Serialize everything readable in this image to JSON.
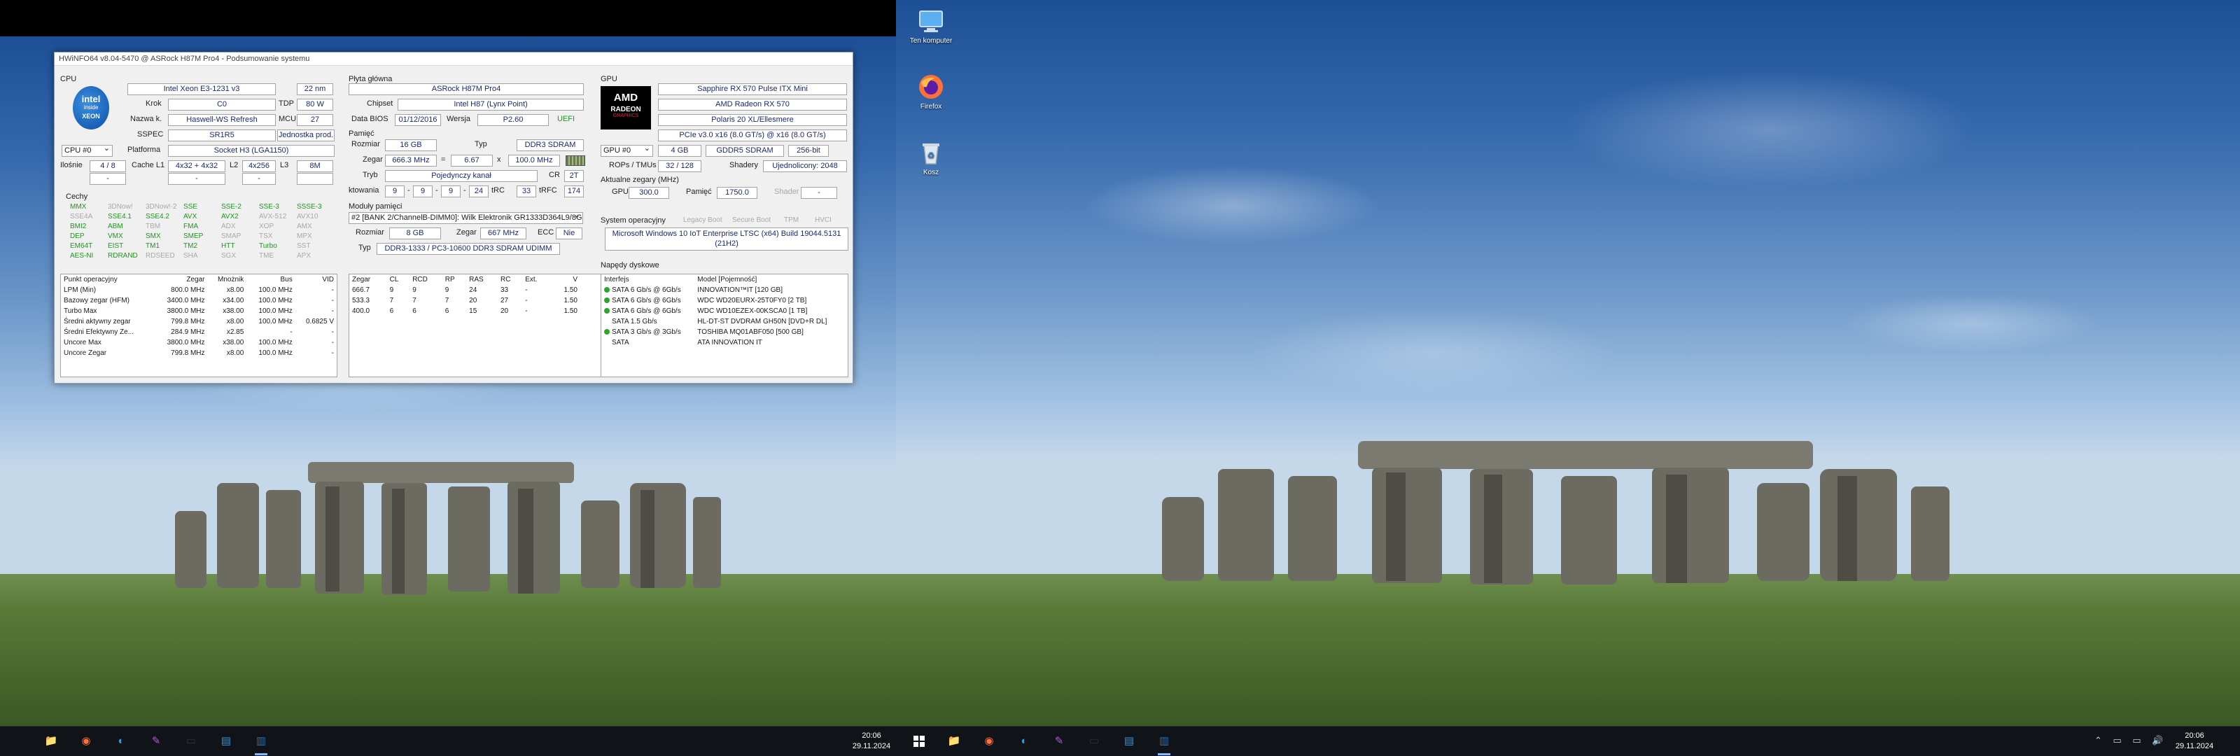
{
  "window": {
    "title": "HWiNFO64 v8.04-5470 @ ASRock H87M Pro4 - Podsumowanie systemu"
  },
  "cpu": {
    "section": "CPU",
    "logo": {
      "brand": "intel",
      "inside": "inside",
      "name": "XEON"
    },
    "model": "Intel Xeon E3-1231 v3",
    "process": "22 nm",
    "stepping_label": "Krok",
    "stepping": "C0",
    "tdp_label": "TDP",
    "tdp": "80 W",
    "codename_label": "Nazwa k.",
    "codename": "Haswell-WS Refresh",
    "mcu_label": "MCU",
    "mcu": "27",
    "sspec_label": "SSPEC",
    "sspec": "SR1R5",
    "prod_unit": "Jednostka prod.",
    "selector": "CPU #0",
    "platform_label": "Platforma",
    "platform": "Socket H3 (LGA1150)",
    "cores_label": "Ilośnie",
    "cores": "4 / 8",
    "cache_l1_label": "Cache L1",
    "cache_l1": "4x32 + 4x32",
    "l2_label": "L2",
    "l2": "4x256",
    "l3_label": "L3",
    "l3": "8M",
    "features_label": "Cechy",
    "features": [
      [
        "MMX",
        "on"
      ],
      [
        "3DNow!",
        "off"
      ],
      [
        "3DNow!-2",
        "off"
      ],
      [
        "SSE",
        "on"
      ],
      [
        "SSE-2",
        "on"
      ],
      [
        "SSE-3",
        "on"
      ],
      [
        "SSSE-3",
        "on"
      ],
      [
        "SSE4A",
        "off"
      ],
      [
        "SSE4.1",
        "on"
      ],
      [
        "SSE4.2",
        "on"
      ],
      [
        "AVX",
        "on"
      ],
      [
        "AVX2",
        "on"
      ],
      [
        "AVX-512",
        "off"
      ],
      [
        "AVX10",
        "off"
      ],
      [
        "BMI2",
        "on"
      ],
      [
        "ABM",
        "on"
      ],
      [
        "TBM",
        "off"
      ],
      [
        "FMA",
        "on"
      ],
      [
        "ADX",
        "off"
      ],
      [
        "XOP",
        "off"
      ],
      [
        "AMX",
        "off"
      ],
      [
        "DEP",
        "on"
      ],
      [
        "VMX",
        "on"
      ],
      [
        "SMX",
        "on"
      ],
      [
        "SMEP",
        "on"
      ],
      [
        "SMAP",
        "off"
      ],
      [
        "TSX",
        "off"
      ],
      [
        "MPX",
        "off"
      ],
      [
        "EM64T",
        "on"
      ],
      [
        "EIST",
        "on"
      ],
      [
        "TM1",
        "on"
      ],
      [
        "TM2",
        "on"
      ],
      [
        "HTT",
        "on"
      ],
      [
        "Turbo",
        "on"
      ],
      [
        "SST",
        "off"
      ],
      [
        "AES-NI",
        "on"
      ],
      [
        "RDRAND",
        "on"
      ],
      [
        "RDSEED",
        "off"
      ],
      [
        "SHA",
        "off"
      ],
      [
        "SGX",
        "off"
      ],
      [
        "TME",
        "off"
      ],
      [
        "APX",
        "off"
      ]
    ],
    "op_table": {
      "headers": [
        "Punkt operacyjny",
        "Zegar",
        "Mnożnik",
        "Bus",
        "VID"
      ],
      "rows": [
        [
          "LPM (Min)",
          "800.0 MHz",
          "x8.00",
          "100.0 MHz",
          "-"
        ],
        [
          "Bazowy zegar (HFM)",
          "3400.0 MHz",
          "x34.00",
          "100.0 MHz",
          "-"
        ],
        [
          "Turbo Max",
          "3800.0 MHz",
          "x38.00",
          "100.0 MHz",
          "-"
        ],
        [
          "Średni aktywny zegar",
          "799.8 MHz",
          "x8.00",
          "100.0 MHz",
          "0.6825 V"
        ],
        [
          "Średni Efektywny Ze...",
          "284.9 MHz",
          "x2.85",
          "-",
          "-"
        ],
        [
          "Uncore Max",
          "3800.0 MHz",
          "x38.00",
          "100.0 MHz",
          "-"
        ],
        [
          "Uncore Zegar",
          "799.8 MHz",
          "x8.00",
          "100.0 MHz",
          "-"
        ]
      ]
    }
  },
  "mobo": {
    "section": "Płyta główna",
    "model": "ASRock H87M Pro4",
    "chipset_label": "Chipset",
    "chipset": "Intel H87 (Lynx Point)",
    "bios_label": "Data BIOS",
    "bios_date": "01/12/2016",
    "version_label": "Wersja",
    "version": "P2.60",
    "uefi": "UEFI"
  },
  "memory": {
    "section": "Pamięć",
    "size_label": "Rozmiar",
    "size": "16 GB",
    "type_label": "Typ",
    "type": "DDR3 SDRAM",
    "clock_label": "Zegar",
    "clock": "666.3 MHz",
    "eq": "=",
    "mult": "6.67",
    "x": "x",
    "bus": "100.0 MHz",
    "mode_label": "Tryb",
    "mode": "Pojedynczy kanał",
    "cr_label": "CR",
    "cr": "2T",
    "timing_label": "ktowania",
    "t1": "9",
    "t2": "9",
    "t3": "9",
    "t4": "24",
    "trc_label": "tRC",
    "trc": "33",
    "trfc_label": "tRFC",
    "trfc": "174",
    "modules_label": "Moduły pamięci",
    "module": "#2 [BANK 2/ChannelB-DIMM0]: Wilk Elektronik GR1333D364L9/8G",
    "m_size_label": "Rozmiar",
    "m_size": "8 GB",
    "m_clock_label": "Zegar",
    "m_clock": "667 MHz",
    "ecc_label": "ECC",
    "ecc": "Nie",
    "m_type_label": "Typ",
    "m_type": "DDR3-1333 / PC3-10600 DDR3 SDRAM UDIMM",
    "timing_table": {
      "headers": [
        "Zegar",
        "CL",
        "RCD",
        "RP",
        "RAS",
        "RC",
        "Ext.",
        "V"
      ],
      "rows": [
        [
          "666.7",
          "9",
          "9",
          "9",
          "24",
          "33",
          "-",
          "1.50"
        ],
        [
          "533.3",
          "7",
          "7",
          "7",
          "20",
          "27",
          "-",
          "1.50"
        ],
        [
          "400.0",
          "6",
          "6",
          "6",
          "15",
          "20",
          "-",
          "1.50"
        ]
      ]
    }
  },
  "gpu": {
    "section": "GPU",
    "logo": {
      "brand": "AMD",
      "line1": "RADEON",
      "line2": "GRAPHICS"
    },
    "card": "Sapphire RX 570 Pulse ITX Mini",
    "chip": "AMD Radeon RX 570",
    "core": "Polaris 20 XL/Ellesmere",
    "pcie": "PCIe v3.0 x16 (8.0 GT/s) @ x16 (8.0 GT/s)",
    "selector": "GPU #0",
    "vram": "4 GB",
    "vram_type": "GDDR5 SDRAM",
    "bus_width": "256-bit",
    "rops_label": "ROPs / TMUs",
    "rops": "32 / 128",
    "shaders_label": "Shadery",
    "shaders": "Ujednolicony: 2048",
    "clocks_label": "Aktualne zegary (MHz)",
    "gpu_clk_label": "GPU",
    "gpu_clk": "300.0",
    "mem_clk_label": "Pamięć",
    "mem_clk": "1750.0",
    "shader_label": "Shader",
    "shader": "-"
  },
  "os": {
    "section": "System operacyjny",
    "flags": [
      "Legacy Boot",
      "Secure Boot",
      "TPM",
      "HVCI"
    ],
    "line1": "Microsoft Windows 10 IoT Enterprise LTSC (x64) Build 19044.5131",
    "line2": "(21H2)"
  },
  "drives": {
    "section": "Napędy dyskowe",
    "headers": [
      "Interfejs",
      "Model [Pojemność]"
    ],
    "rows": [
      [
        "SATA 6 Gb/s @ 6Gb/s",
        "INNOVATION™IT [120 GB]",
        true
      ],
      [
        "SATA 6 Gb/s @ 6Gb/s",
        "WDC WD20EURX-25T0FY0 [2 TB]",
        true
      ],
      [
        "SATA 6 Gb/s @ 6Gb/s",
        "WDC WD10EZEX-00KSCA0 [1 TB]",
        true
      ],
      [
        "SATA 1.5 Gb/s",
        "HL-DT-ST DVDRAM GH50N [DVD+R DL]",
        false
      ],
      [
        "SATA 3 Gb/s @ 3Gb/s",
        "TOSHIBA MQ01ABF050 [500 GB]",
        true
      ],
      [
        "SATA",
        "ATA INNOVATION  IT",
        false
      ]
    ]
  },
  "desktop": {
    "icons": [
      {
        "label": "Ten komputer",
        "icon": "computer-icon"
      },
      {
        "label": "Firefox",
        "icon": "firefox-icon"
      },
      {
        "label": "Kosz",
        "icon": "recycle-bin-icon"
      }
    ]
  },
  "taskbar": {
    "left_clock": {
      "time": "20:06",
      "date": "29.11.2024"
    },
    "right_clock": {
      "time": "20:06",
      "date": "29.11.2024"
    },
    "apps": [
      "file-explorer-icon",
      "firefox-icon",
      "edge-icon",
      "notepad-icon",
      "terminal-icon",
      "hwinfo-icon",
      "hwinfo-app-icon"
    ],
    "tray": "⌃ ▭ ▭ 🔊"
  },
  "colors": {
    "accent": "#7fb6ff",
    "taskbar": "#101418",
    "feature_on": "#1a9a1a",
    "feature_off": "#a8a8a8"
  }
}
